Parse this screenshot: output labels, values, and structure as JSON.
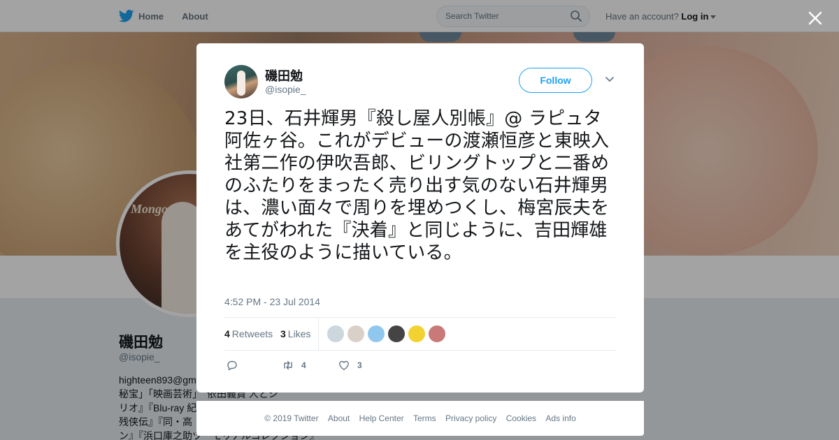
{
  "topbar": {
    "home_label": "Home",
    "about_label": "About",
    "search_placeholder": "Search Twitter",
    "have_account_text": "Have an account?",
    "login_label": "Log in"
  },
  "background_profile": {
    "name": "磯田勉",
    "handle": "@isopie_",
    "bio_lines": [
      "highteen893@gm",
      "秘宝」「映画芸術」　依田義賢 人とシ",
      "リオ』『Blu-ray 紀",
      "残侠伝』『同・高",
      "ン』『浜口庫之助ツ　モリアルコレクション』"
    ],
    "avatar_text": "Mongo Santamaria"
  },
  "tweet": {
    "author_name": "磯田勉",
    "author_handle": "@isopie_",
    "follow_label": "Follow",
    "text": "23日、石井輝男『殺し屋人別帳』@ ラピュタ阿佐ヶ谷。これがデビューの渡瀬恒彦と東映入社第二作の伊吹吾郎、ビリングトップと二番めのふたりをまったく売り出す気のない石井輝男は、濃い面々で周りを埋めつくし、梅宮辰夫をあてがわれた『決着』と同じように、吉田輝雄を主役のように描いている。",
    "timestamp": "4:52 PM - 23 Jul 2014",
    "retweets_count": "4",
    "retweets_label": "Retweets",
    "likes_count": "3",
    "likes_label": "Likes",
    "retweet_action_count": "4",
    "like_action_count": "3",
    "likers": [
      {
        "icon": "default-avatar-icon",
        "color": "#ccd6dd"
      },
      {
        "icon": "avatar-icon",
        "color": "#d9d0c8"
      },
      {
        "icon": "avatar-icon",
        "color": "#8fc7ef"
      },
      {
        "icon": "avatar-icon",
        "color": "#444444"
      },
      {
        "icon": "avatar-icon",
        "color": "#f2d230"
      },
      {
        "icon": "avatar-icon",
        "color": "#c97a78"
      }
    ]
  },
  "footer": {
    "links": [
      "© 2019 Twitter",
      "About",
      "Help Center",
      "Terms",
      "Privacy policy",
      "Cookies",
      "Ads info"
    ]
  },
  "colors": {
    "accent": "#1da1f2",
    "text_primary": "#14171a",
    "text_secondary": "#657786"
  }
}
